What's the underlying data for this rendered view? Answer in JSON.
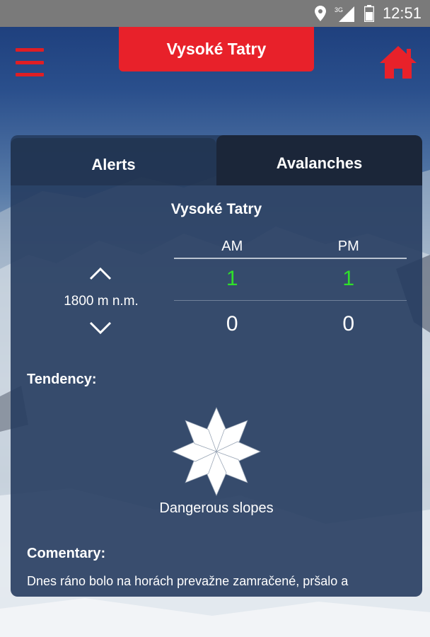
{
  "status_bar": {
    "network_label": "3G",
    "time": "12:51"
  },
  "header": {
    "title": "Vysoké Tatry"
  },
  "tabs": [
    {
      "label": "Alerts"
    },
    {
      "label": "Avalanches"
    }
  ],
  "avalanche": {
    "region": "Vysoké Tatry",
    "columns": [
      "AM",
      "PM"
    ],
    "altitude": "1800 m n.m.",
    "rows": [
      {
        "am": "1",
        "pm": "1"
      },
      {
        "am": "0",
        "pm": "0"
      }
    ],
    "tendency_label": "Tendency:",
    "slopes_label": "Dangerous slopes",
    "commentary_label": "Comentary:",
    "commentary_text": "Dnes ráno bolo na horách prevažne zamračené, pršalo a"
  },
  "colors": {
    "accent": "#e8212a",
    "danger_level_1": "#2fe02a",
    "panel": "#263c5f"
  },
  "icons": {
    "menu": "hamburger-icon",
    "home": "home-icon",
    "up": "chevron-up-icon",
    "down": "chevron-down-icon",
    "rose": "compass-rose-icon"
  }
}
